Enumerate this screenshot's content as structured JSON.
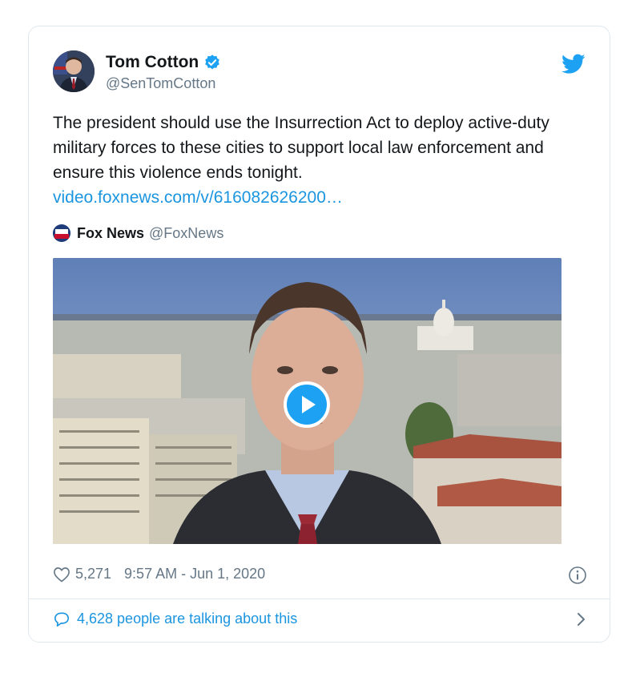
{
  "author": {
    "name": "Tom Cotton",
    "handle": "@SenTomCotton"
  },
  "tweet": {
    "text": "The president should use the Insurrection Act to deploy active-duty military forces to these cities to support local law enforcement and ensure this violence ends tonight.",
    "link": "video.foxnews.com/v/616082626200…"
  },
  "quoted": {
    "name": "Fox News",
    "handle": "@FoxNews"
  },
  "footer": {
    "likes": "5,271",
    "timestamp": "9:57 AM - Jun 1, 2020"
  },
  "conversation": {
    "label": "4,628 people are talking about this"
  },
  "colors": {
    "twitter_blue": "#1da1f2",
    "link_blue": "#1b95e0",
    "muted_gray": "#657786"
  }
}
